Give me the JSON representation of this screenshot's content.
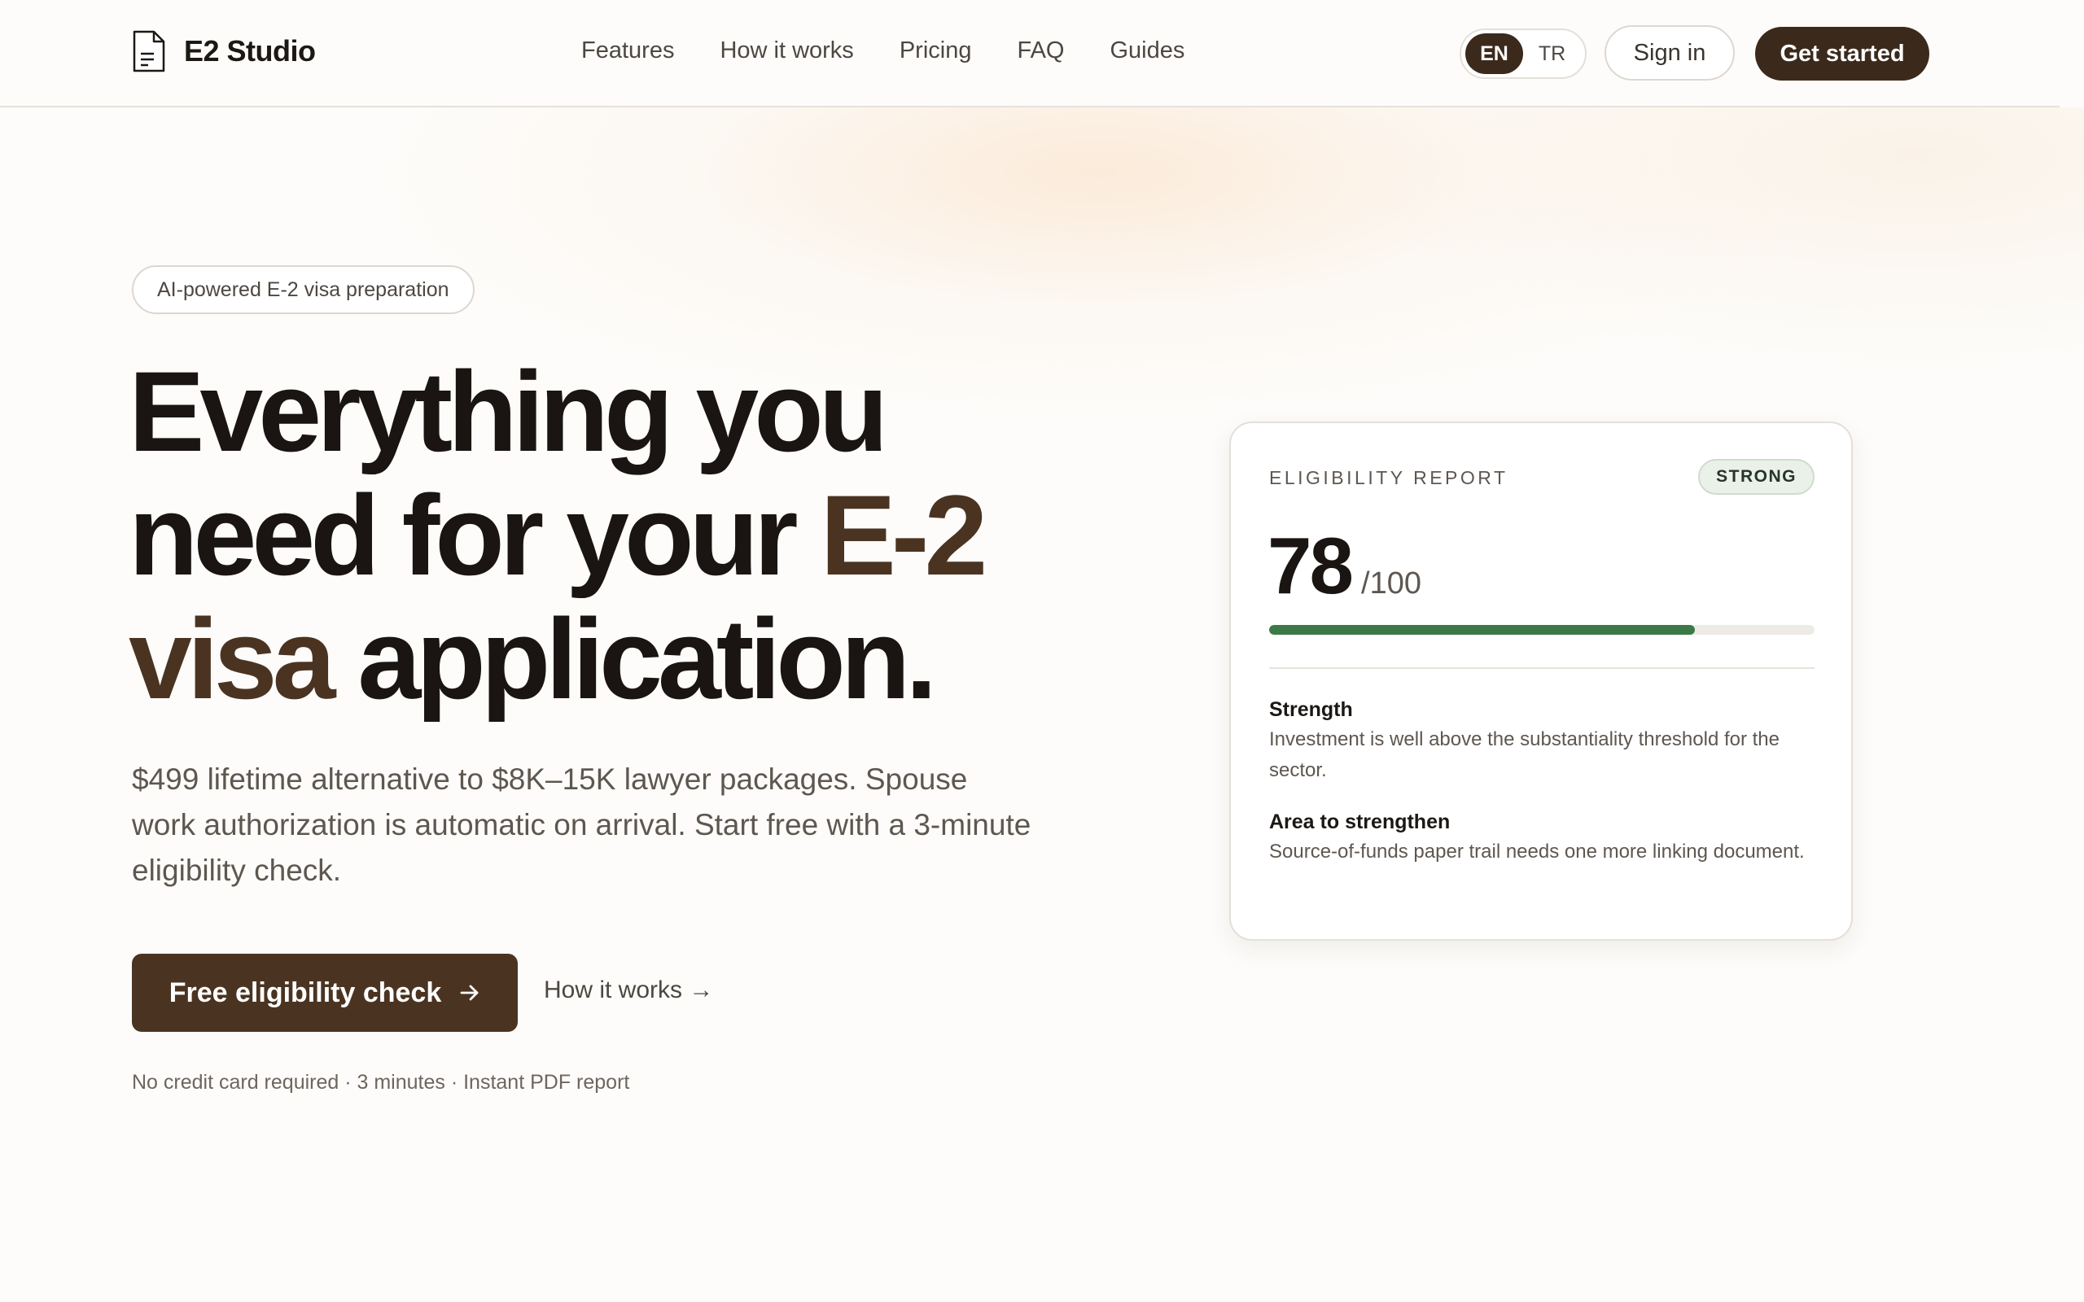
{
  "brand": {
    "name": "E2 Studio"
  },
  "nav": {
    "items": [
      "Features",
      "How it works",
      "Pricing",
      "FAQ",
      "Guides"
    ]
  },
  "lang": {
    "options": [
      "EN",
      "TR"
    ],
    "active": "EN"
  },
  "header": {
    "signin_label": "Sign in",
    "cta_label": "Get started"
  },
  "hero": {
    "badge": "AI-powered E-2 visa preparation",
    "headline_part1": "Everything you need for your ",
    "headline_accent": "E-2 visa",
    "headline_part2": " application.",
    "subtext": "$499 lifetime alternative to $8K–15K lawyer packages. Spouse work authorization is automatic on arrival. Start free with a 3-minute eligibility check.",
    "cta_label": "Free eligibility check",
    "secondary_link": "How it works →",
    "meta": "No credit card required · 3 minutes · Instant PDF report"
  },
  "report": {
    "label": "ELIGIBILITY REPORT",
    "badge": "STRONG",
    "score": "78",
    "score_max": "/100",
    "progress_fraction": 0.78,
    "strength_title": "Strength",
    "strength_text": "Investment is well above the substantiality threshold for the sector.",
    "improve_title": "Area to strengthen",
    "improve_text": "Source-of-funds paper trail needs one more linking document."
  },
  "colors": {
    "accent": "#4a3421",
    "dark_brown": "#3b2a1c",
    "progress_green": "#3b7a48",
    "badge_bg": "#eaf1e8"
  },
  "icons": {
    "logo": "document-icon",
    "cta": "arrow-right-icon"
  }
}
